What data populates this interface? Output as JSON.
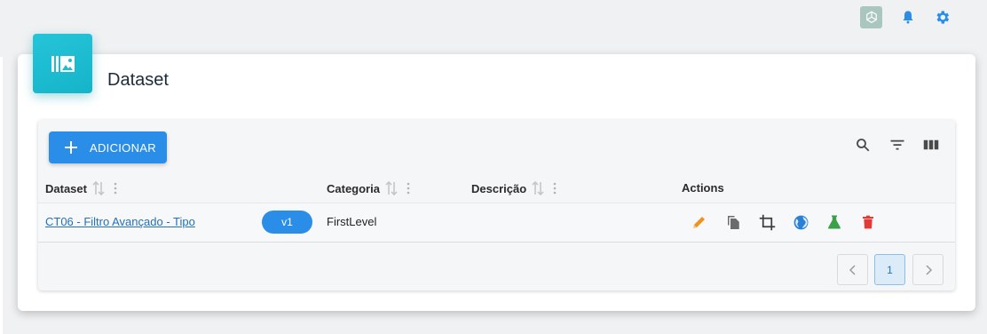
{
  "header": {
    "icons": [
      "openai-icon",
      "bell-icon",
      "gear-icon"
    ]
  },
  "card": {
    "title": "Dataset",
    "icon": "library-image-icon",
    "accent_color": "#1ebdd2"
  },
  "toolbar": {
    "add_label": "ADICIONAR",
    "icons": [
      "search-icon",
      "filter-icon",
      "columns-icon"
    ],
    "primary_color": "#2a8ee8"
  },
  "table": {
    "columns": [
      {
        "label": "Dataset",
        "sortable": true
      },
      {
        "label": "Categoria",
        "sortable": true
      },
      {
        "label": "Descrição",
        "sortable": true
      },
      {
        "label": "Actions",
        "sortable": false
      }
    ],
    "rows": [
      {
        "dataset": "CT06 - Filtro Avançado - Tipo",
        "version": "v1",
        "categoria": "FirstLevel",
        "descricao": "",
        "actions": [
          "edit-icon",
          "copy-icon",
          "crop-icon",
          "globe-icon",
          "flask-icon",
          "delete-icon"
        ]
      }
    ]
  },
  "pagination": {
    "prev_icon": "chevron-left-icon",
    "current_page": "1",
    "next_icon": "chevron-right-icon"
  },
  "colors": {
    "edit": "#f0921e",
    "copy": "#6b6b6b",
    "crop": "#3d3d3d",
    "globe": "#2a7fd8",
    "flask": "#3aa04a",
    "delete": "#e53935"
  }
}
